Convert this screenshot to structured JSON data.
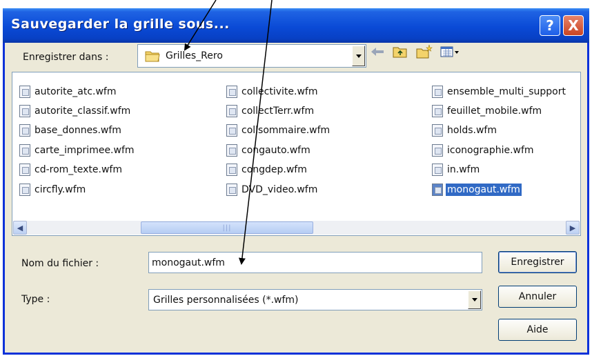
{
  "window": {
    "title": "Sauvegarder la grille sous...",
    "help_glyph": "?",
    "close_glyph": "X"
  },
  "save_in": {
    "label": "Enregistrer dans :",
    "folder": "Grilles_Rero",
    "folder_icon": "folder-icon"
  },
  "toolbar": {
    "icons": [
      "back-arrow-icon",
      "up-folder-icon",
      "new-folder-icon",
      "view-menu-icon"
    ]
  },
  "files": {
    "columns": [
      [
        "autorite_atc.wfm",
        "autorite_classif.wfm",
        "base_donnes.wfm",
        "carte_imprimee.wfm",
        "cd-rom_texte.wfm",
        "circfly.wfm"
      ],
      [
        "collectivite.wfm",
        "collectTerr.wfm",
        "collsommaire.wfm",
        "congauto.wfm",
        "congdep.wfm",
        "DVD_video.wfm"
      ],
      [
        "ensemble_multi_support",
        "feuillet_mobile.wfm",
        "holds.wfm",
        "iconographie.wfm",
        "in.wfm",
        "monogaut.wfm"
      ]
    ],
    "selected": "monogaut.wfm"
  },
  "filename": {
    "label": "Nom du fichier :",
    "value": "monogaut.wfm"
  },
  "filetype": {
    "label": "Type :",
    "value": "Grilles personnalisées (*.wfm)"
  },
  "buttons": {
    "save": "Enregistrer",
    "cancel": "Annuler",
    "help": "Aide"
  },
  "colors": {
    "titlebar": "#0a4ad6",
    "selection": "#316ac5",
    "dialog_bg": "#ece9d8"
  }
}
